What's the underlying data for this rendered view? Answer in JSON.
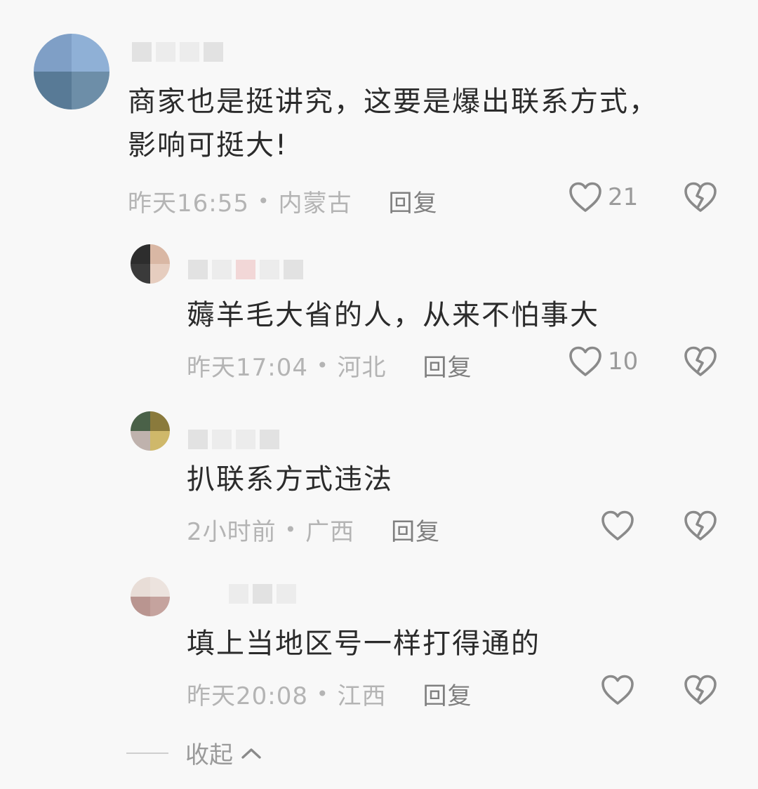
{
  "comments": [
    {
      "text": "商家也是挺讲究，这要是爆出联系方式，\n影响可挺大!",
      "time": "昨天16:55",
      "location": "内蒙古",
      "reply_label": "回复",
      "likes": "21",
      "avatar_colors": [
        "#7f9fc6",
        "#8fb0d6",
        "#587a96",
        "#6d8ea8"
      ]
    },
    {
      "text": "薅羊毛大省的人，从来不怕事大",
      "time": "昨天17:04",
      "location": "河北",
      "reply_label": "回复",
      "likes": "10",
      "avatar_colors": [
        "#2d2d2d",
        "#d9b7a4",
        "#3a3a3a",
        "#e6cdbf"
      ]
    },
    {
      "text": "扒联系方式违法",
      "time": "2小时前",
      "location": "广西",
      "reply_label": "回复",
      "likes": "",
      "avatar_colors": [
        "#4a6148",
        "#8a7a3c",
        "#bfb2ad",
        "#cfb86a"
      ]
    },
    {
      "text": "填上当地区号一样打得通的",
      "time": "昨天20:08",
      "location": "江西",
      "reply_label": "回复",
      "likes": "",
      "avatar_colors": [
        "#e8ddd7",
        "#ece3de",
        "#b99590",
        "#c5a39e"
      ]
    }
  ],
  "collapse_label": "收起",
  "icons": {
    "like": "heart-outline-icon",
    "dislike": "broken-heart-icon",
    "collapse": "chevron-up-icon"
  }
}
